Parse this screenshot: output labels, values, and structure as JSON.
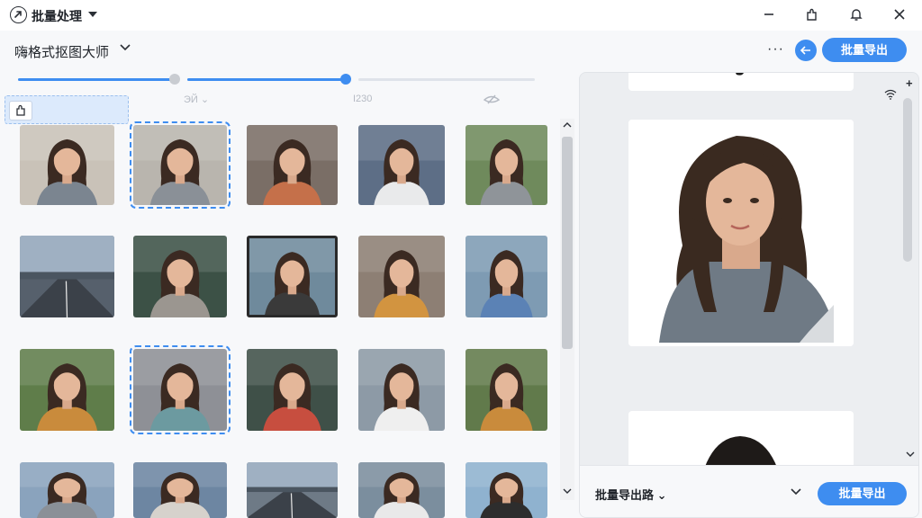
{
  "titlebar": {
    "title": "批量处理",
    "icons": [
      "app-logo-icon",
      "minimize-icon",
      "puzzle-icon",
      "bell-icon",
      "close-icon"
    ]
  },
  "header": {
    "project_name": "嗨格式抠图大师",
    "more_label": "···",
    "export_label": "批量导出"
  },
  "sliders": [
    {
      "fill": 0.98,
      "knob_color": "#c9ccd1"
    },
    {
      "fill": 1.0,
      "knob_color": "#3e8df0"
    },
    {
      "fill": 0.0,
      "knob_color": ""
    }
  ],
  "slider_labels": [
    "ЭЙ ⌄",
    "I230"
  ],
  "grid": {
    "items": [
      {
        "bg": "#c9c2b8",
        "shirt": "#7b8590",
        "selected": false,
        "framed": false
      },
      {
        "bg": "#b9b5ae",
        "shirt": "#8a9097",
        "selected": true,
        "framed": false
      },
      {
        "bg": "#7a6e66",
        "shirt": "#c5704a",
        "selected": false,
        "framed": false
      },
      {
        "bg": "#5d6e86",
        "shirt": "#e9eaeb",
        "selected": false,
        "framed": false
      },
      {
        "bg": "#6f8a5c",
        "shirt": "#8f9499",
        "selected": false,
        "framed": false
      },
      {
        "bg": "#56606c",
        "shirt": "",
        "selected": false,
        "framed": false,
        "scene": "road"
      },
      {
        "bg": "#3c5146",
        "shirt": "#9b9690",
        "selected": false,
        "framed": false
      },
      {
        "bg": "#6f8a9c",
        "shirt": "#3a3a3a",
        "selected": false,
        "framed": true
      },
      {
        "bg": "#8d7f74",
        "shirt": "#d29440",
        "selected": false,
        "framed": false
      },
      {
        "bg": "#7e9bb3",
        "shirt": "#5b82b5",
        "selected": false,
        "framed": false
      },
      {
        "bg": "#5f7d4a",
        "shirt": "#c98b3c",
        "selected": false,
        "framed": false
      },
      {
        "bg": "#8e9096",
        "shirt": "#6c9aa0",
        "selected": true,
        "framed": false
      },
      {
        "bg": "#3f5048",
        "shirt": "#c74e3f",
        "selected": false,
        "framed": false
      },
      {
        "bg": "#8d9aa6",
        "shirt": "#efefef",
        "selected": false,
        "framed": false
      },
      {
        "bg": "#617a4b",
        "shirt": "#c98b3c",
        "selected": false,
        "framed": false
      },
      {
        "bg": "#8aa3bd",
        "shirt": "#8a9097",
        "selected": false,
        "framed": false
      },
      {
        "bg": "#6d86a2",
        "shirt": "#d6d2cc",
        "selected": false,
        "framed": false
      },
      {
        "bg": "#6e7a86",
        "shirt": "",
        "selected": false,
        "framed": false,
        "scene": "road"
      },
      {
        "bg": "#7b8e9e",
        "shirt": "#e9e9e9",
        "selected": false,
        "framed": false
      },
      {
        "bg": "#8fb2cf",
        "shirt": "#2d2d2d",
        "selected": false,
        "framed": false
      }
    ]
  },
  "preview_panel": {
    "footer_label": "批量导出路 ⌄",
    "export_label": "批量导出",
    "icons": [
      "plus-icon",
      "wifi-icon",
      "scroll-down-icon"
    ]
  },
  "colors": {
    "accent": "#3e8df0",
    "background": "#f7f8fa",
    "panel": "#eceef1"
  }
}
